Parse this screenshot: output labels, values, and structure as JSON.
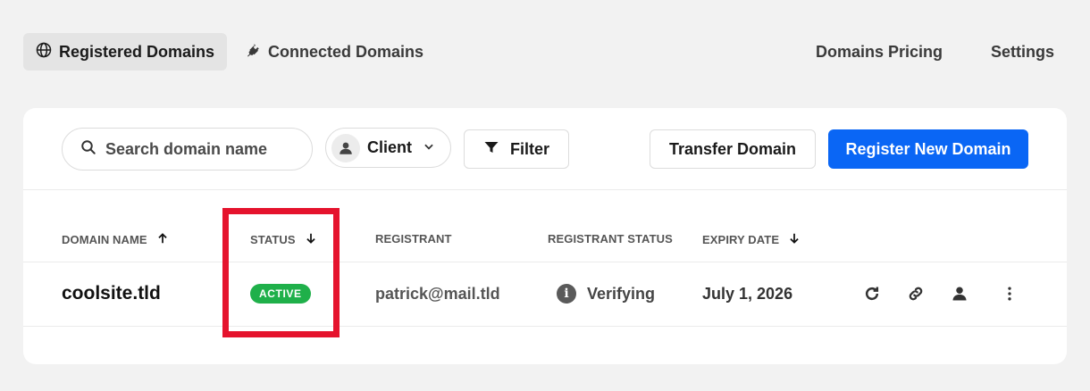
{
  "nav": {
    "tabs": [
      {
        "label": "Registered Domains",
        "icon": "globe-icon",
        "active": true
      },
      {
        "label": "Connected Domains",
        "icon": "plug-icon",
        "active": false
      }
    ],
    "links": [
      "Domains Pricing",
      "Settings"
    ]
  },
  "toolbar": {
    "search_placeholder": "Search domain name",
    "client_label": "Client",
    "filter_label": "Filter",
    "transfer_label": "Transfer Domain",
    "register_label": "Register New Domain"
  },
  "table": {
    "columns": [
      "DOMAIN NAME",
      "STATUS",
      "REGISTRANT",
      "REGISTRANT STATUS",
      "EXPIRY DATE"
    ],
    "rows": [
      {
        "domain": "coolsite.tld",
        "status": "ACTIVE",
        "registrant": "patrick@mail.tld",
        "registrant_status": "Verifying",
        "expiry": "July 1, 2026",
        "actions": [
          "refresh-icon",
          "link-icon",
          "user-icon",
          "more-icon"
        ]
      }
    ]
  },
  "colors": {
    "primary": "#0a66f5",
    "active_badge": "#1fb04a",
    "highlight": "#e5132d"
  }
}
